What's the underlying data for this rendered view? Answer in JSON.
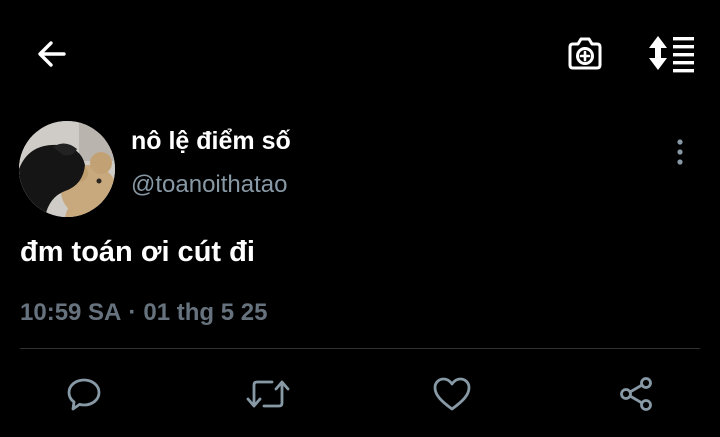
{
  "topbar": {
    "back_icon": "arrow-left-icon",
    "camera_icon": "camera-add-icon",
    "sort_icon": "sort-list-icon"
  },
  "tweet": {
    "author": {
      "display_name": "nô lệ điểm số",
      "handle": "@toanoithatao",
      "avatar": "avatar-photo-teddy-bear"
    },
    "more_icon": "more-vertical-icon",
    "text": "đm toán ơi cút đi",
    "time": "10:59 SA",
    "separator": "·",
    "date": "01 thg 5 25"
  },
  "actions": [
    {
      "icon": "reply-icon"
    },
    {
      "icon": "retweet-icon"
    },
    {
      "icon": "like-icon"
    },
    {
      "icon": "share-icon"
    }
  ],
  "colors": {
    "background": "#000000",
    "text_primary": "#ffffff",
    "text_secondary": "#8899a6",
    "meta_text": "#66727d",
    "divider": "#2f3336",
    "icon": "#8899a6"
  }
}
